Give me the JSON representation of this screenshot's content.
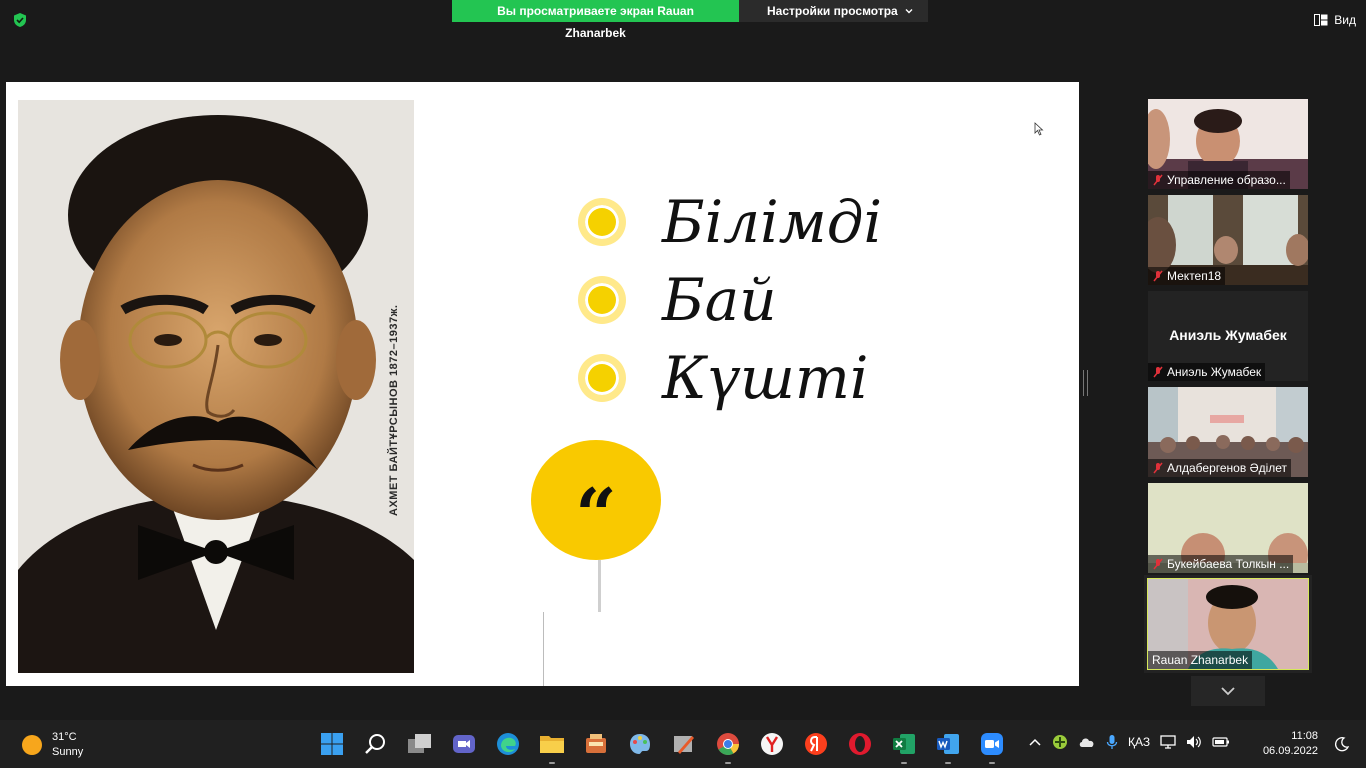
{
  "banner": {
    "sharing_text": "Вы просматриваете экран Rauan Zhanarbek",
    "view_settings_label": "Настройки просмотра",
    "view_label": "Вид"
  },
  "slide": {
    "portrait_caption": "АХМЕТ БАЙТҰРСЫНОВ 1872–1937ж.",
    "bullets": [
      "Білімді",
      "Бай",
      "Күшті"
    ],
    "quote_mark": "“"
  },
  "participants": [
    {
      "name": "Управление образо...",
      "muted": true
    },
    {
      "name": "Мектеп18",
      "muted": true
    },
    {
      "name": "Аниэль Жумабек",
      "muted": true,
      "display_name": "Аниэль Жумабек"
    },
    {
      "name": "Алдабергенов Әділет",
      "muted": true
    },
    {
      "name": "Букейбаева Толкын ...",
      "muted": true
    },
    {
      "name": "Rauan Zhanarbek",
      "muted": false,
      "active": true
    }
  ],
  "taskbar": {
    "weather_temp": "31°C",
    "weather_desc": "Sunny",
    "language": "ҚАЗ",
    "time": "11:08",
    "date": "06.09.2022"
  },
  "colors": {
    "banner_green": "#23c552",
    "bullet_yellow": "#f5d100",
    "quote_yellow": "#f9c900",
    "active_border": "#d6e85a"
  }
}
